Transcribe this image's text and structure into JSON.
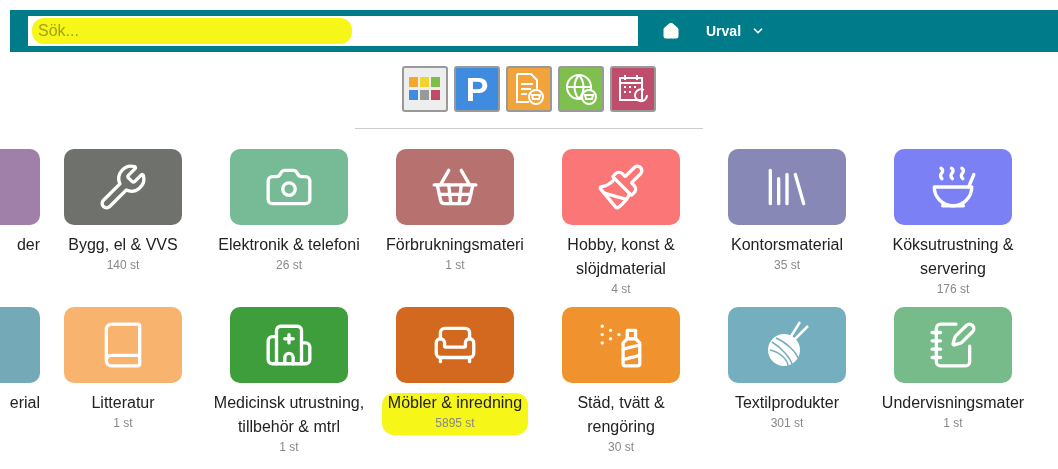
{
  "header": {
    "search": {
      "placeholder": "Sök...",
      "highlighted": true
    },
    "menu": {
      "label": "Urval"
    }
  },
  "toolbar": [
    {
      "kind": "grid",
      "color": "#eeeeee"
    },
    {
      "kind": "letter",
      "label": "P",
      "color": "#3f8be0"
    },
    {
      "kind": "document",
      "color": "#f2a43a"
    },
    {
      "kind": "globe",
      "color": "#7fbf4d"
    },
    {
      "kind": "calendar",
      "color": "#bf4d6c"
    }
  ],
  "categories": [
    {
      "label": "der",
      "color": "#a07fa8",
      "partial": true,
      "highlighted": false
    },
    {
      "label": "Bygg, el & VVS",
      "count": "140 st",
      "color": "#6f726c",
      "partial": false,
      "highlighted": false
    },
    {
      "label": "Elektronik & telefoni",
      "count": "26 st",
      "color": "#77bb96",
      "partial": false,
      "highlighted": false
    },
    {
      "label": "Förbrukningsmateri",
      "count": "1 st",
      "color": "#b77270",
      "partial": false,
      "highlighted": false
    },
    {
      "label": "Hobby, konst & slöjdmaterial",
      "count": "4 st",
      "color": "#fb7676",
      "partial": false,
      "highlighted": false
    },
    {
      "label": "Kontorsmaterial",
      "count": "35 st",
      "color": "#8888b7",
      "partial": false,
      "highlighted": false
    },
    {
      "label": "Köksutrustning & servering",
      "count": "176 st",
      "color": "#7b81f5",
      "partial": false,
      "highlighted": false
    },
    {
      "label": "erial",
      "color": "#74a9b8",
      "partial": true,
      "highlighted": false
    },
    {
      "label": "Litteratur",
      "count": "1 st",
      "color": "#f8b46e",
      "partial": false,
      "highlighted": false
    },
    {
      "label": "Medicinsk utrustning, tillbehör & mtrl",
      "count": "1 st",
      "color": "#3e9e3c",
      "partial": false,
      "highlighted": false
    },
    {
      "label": "Möbler & inredning",
      "count": "5895 st",
      "color": "#d2691f",
      "partial": false,
      "highlighted": true
    },
    {
      "label": "Städ, tvätt & rengöring",
      "count": "30 st",
      "color": "#f0922e",
      "partial": false,
      "highlighted": false
    },
    {
      "label": "Textilprodukter",
      "count": "301 st",
      "color": "#74aebf",
      "partial": false,
      "highlighted": false
    },
    {
      "label": "Undervisningsmater",
      "count": "1 st",
      "color": "#77bb8b",
      "partial": false,
      "highlighted": false
    }
  ]
}
